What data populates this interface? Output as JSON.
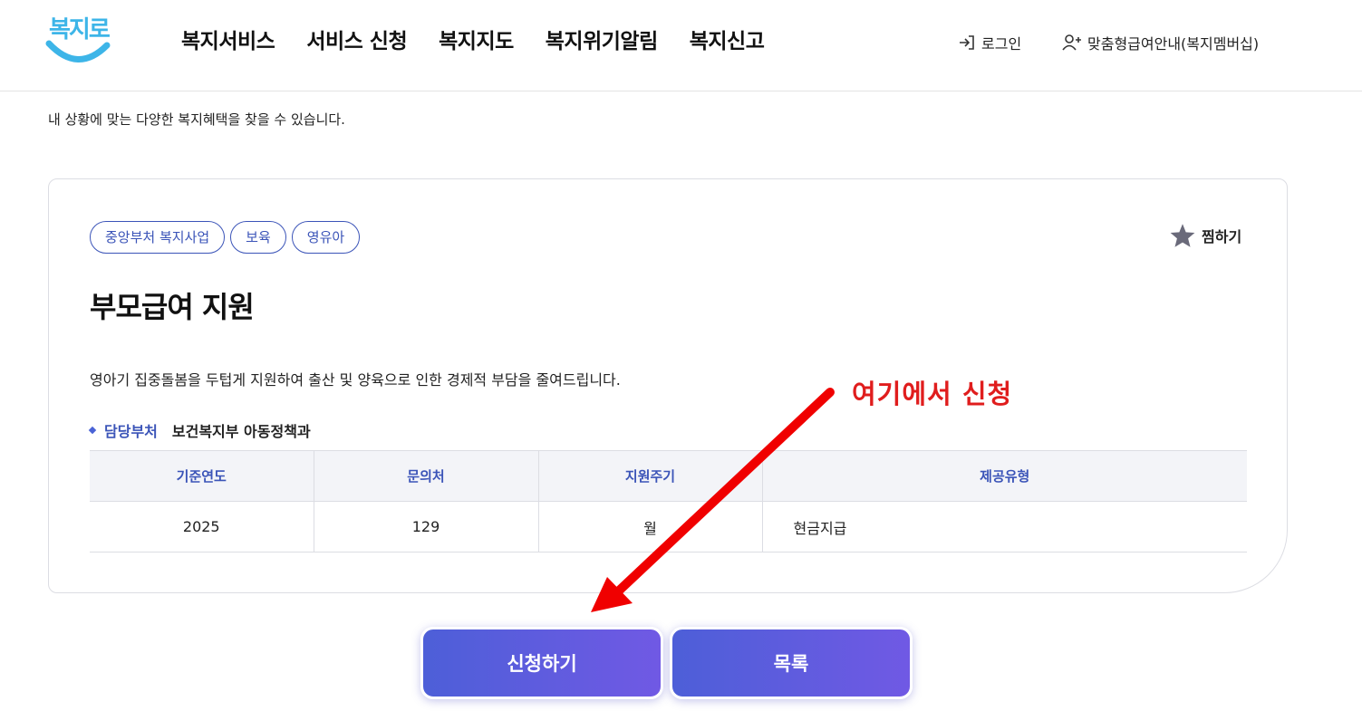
{
  "header": {
    "logo_text": "복지로",
    "nav": [
      "복지서비스",
      "서비스 신청",
      "복지지도",
      "복지위기알림",
      "복지신고"
    ],
    "login_label": "로그인",
    "member_label": "맞춤형급여안내(복지멤버십)"
  },
  "page": {
    "subtitle": "내 상황에 맞는 다양한 복지혜택을 찾을 수 있습니다."
  },
  "service": {
    "tags": [
      "중앙부처 복지사업",
      "보육",
      "영유아"
    ],
    "favorite_label": "찜하기",
    "title": "부모급여 지원",
    "description": "영아기 집중돌봄을 두텁게 지원하여 출산 및 양육으로 인한 경제적 부담을 줄여드립니다.",
    "department_label": "담당부처",
    "department_value": "보건복지부 아동정책과",
    "table": {
      "headers": [
        "기준연도",
        "문의처",
        "지원주기",
        "제공유형"
      ],
      "row": [
        "2025",
        "129",
        "월",
        "현금지급"
      ]
    }
  },
  "buttons": {
    "apply": "신청하기",
    "list": "목록"
  },
  "annotation": {
    "text": "여기에서 신청",
    "color": "#e01d1d"
  },
  "colors": {
    "accent": "#3b54b8",
    "button_gradient_start": "#4d5fd8",
    "button_gradient_end": "#7059e4",
    "logo": "#3db5e8"
  }
}
